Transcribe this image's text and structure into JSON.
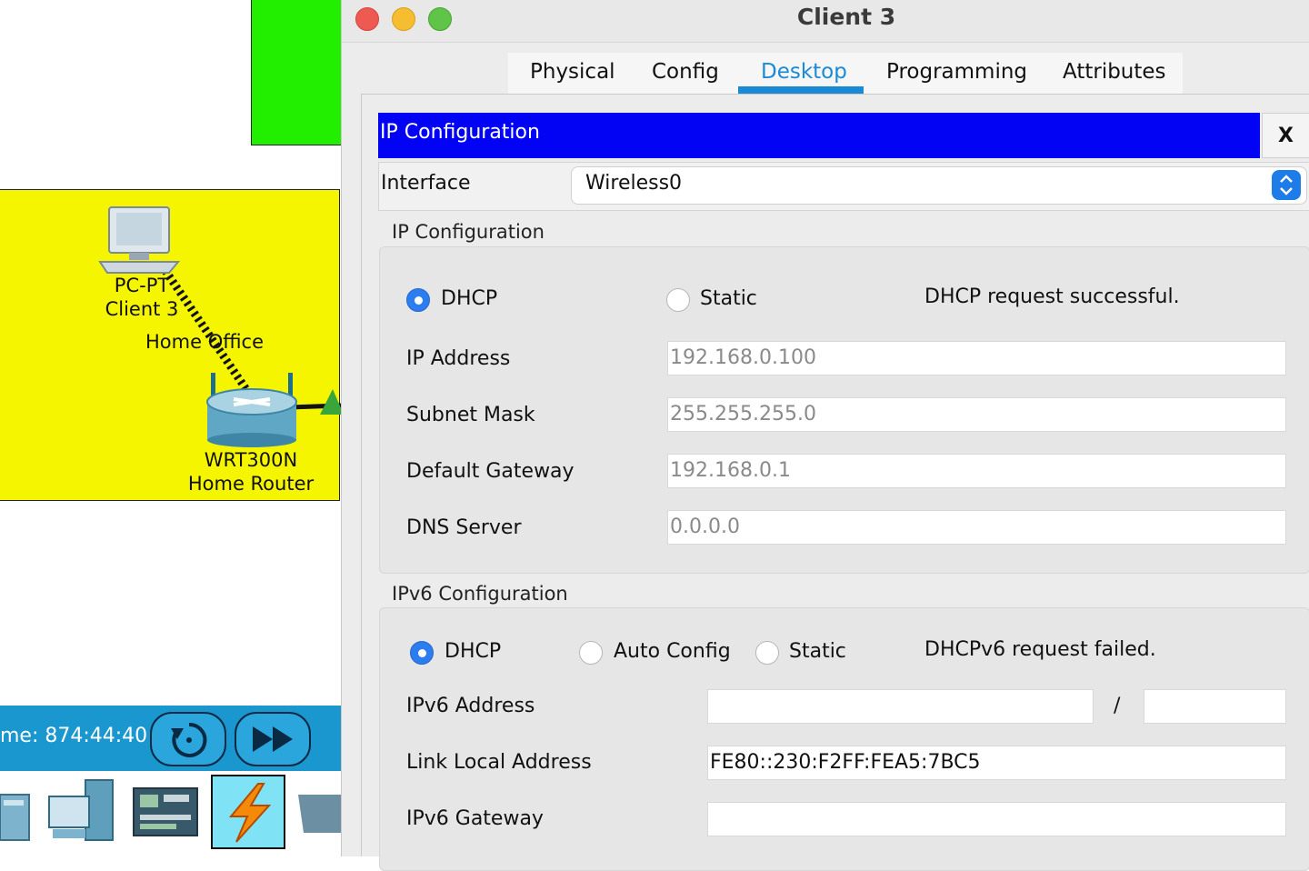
{
  "workspace": {
    "pc": {
      "line1": "PC-PT",
      "line2": "Client 3"
    },
    "area_label": "Home Office",
    "router": {
      "line1": "WRT300N",
      "line2": "Home Router"
    },
    "sim_time": "me: 874:44:40"
  },
  "window": {
    "title": "Client 3",
    "tabs": [
      "Physical",
      "Config",
      "Desktop",
      "Programming",
      "Attributes"
    ],
    "active_tab": "Desktop"
  },
  "ip_config": {
    "header": "IP Configuration",
    "close_label": "X",
    "interface_label": "Interface",
    "interface_value": "Wireless0",
    "ipv4": {
      "section_title": "IP Configuration",
      "mode_dhcp": "DHCP",
      "mode_static": "Static",
      "selected_mode": "DHCP",
      "status": "DHCP request successful.",
      "fields": [
        {
          "label": "IP Address",
          "value": "192.168.0.100"
        },
        {
          "label": "Subnet Mask",
          "value": "255.255.255.0"
        },
        {
          "label": "Default Gateway",
          "value": "192.168.0.1"
        },
        {
          "label": "DNS Server",
          "value": "0.0.0.0"
        }
      ]
    },
    "ipv6": {
      "section_title": "IPv6 Configuration",
      "mode_dhcp": "DHCP",
      "mode_auto": "Auto Config",
      "mode_static": "Static",
      "selected_mode": "DHCP",
      "status": "DHCPv6 request failed.",
      "address_label": "IPv6 Address",
      "address_value": "",
      "prefix_separator": "/",
      "prefix_value": "",
      "link_local_label": "Link Local Address",
      "link_local_value": "FE80::230:F2FF:FEA5:7BC5",
      "gateway_label": "IPv6 Gateway",
      "gateway_value": ""
    }
  },
  "colors": {
    "header_blue": "#0202f5",
    "accent_blue": "#1a8ad6",
    "office_yellow": "#f5f500",
    "zone_green": "#22ee00",
    "sim_bar": "#1b97cf"
  }
}
